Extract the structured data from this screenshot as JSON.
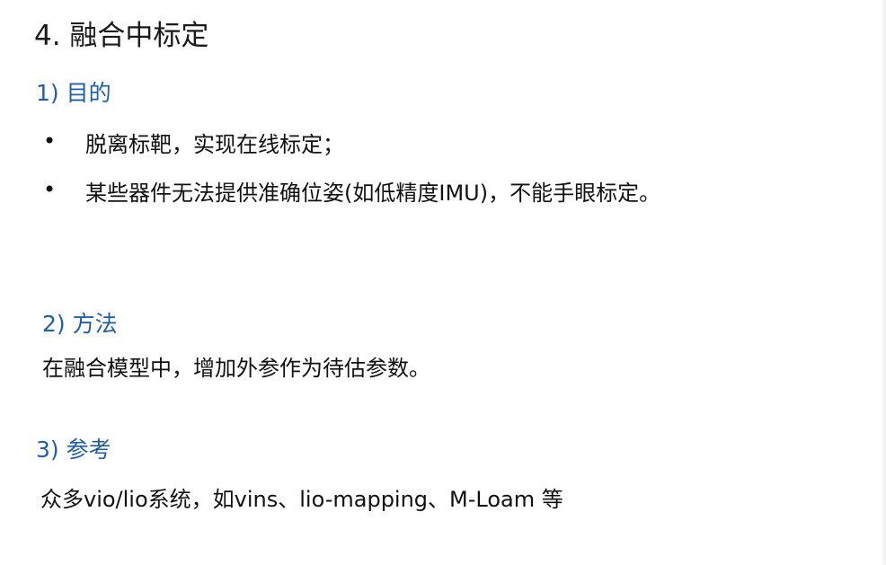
{
  "slide": {
    "title": "4. 融合中标定",
    "sections": [
      {
        "heading": "1) 目的",
        "bullet_symbol": "•",
        "bullets": [
          "脱离标靶，实现在线标定；",
          "某些器件无法提供准确位姿(如低精度IMU)，不能手眼标定。"
        ]
      },
      {
        "heading": "2) 方法",
        "body": "在融合模型中，增加外参作为待估参数。"
      },
      {
        "heading": "3) 参考",
        "body": "众多vio/lio系统，如vins、lio-mapping、M-Loam 等"
      }
    ]
  },
  "colors": {
    "heading_blue": "#1f5fa8",
    "text": "#111111",
    "background": "#ffffff"
  }
}
